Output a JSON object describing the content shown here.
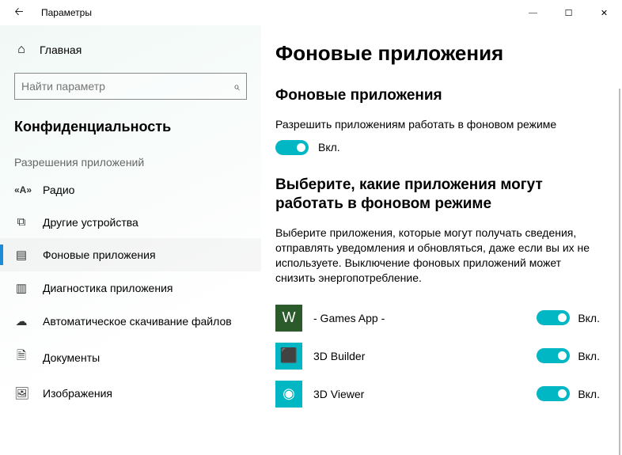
{
  "window": {
    "title": "Параметры"
  },
  "sidebar": {
    "home": "Главная",
    "search_placeholder": "Найти параметр",
    "section": "Конфиденциальность",
    "group": "Разрешения приложений",
    "items": [
      {
        "icon": "A",
        "label": "Радио"
      },
      {
        "icon": "devices",
        "label": "Другие устройства"
      },
      {
        "icon": "bgapps",
        "label": "Фоновые приложения"
      },
      {
        "icon": "diag",
        "label": "Диагностика приложения"
      },
      {
        "icon": "cloud",
        "label": "Автоматическое скачивание файлов"
      },
      {
        "icon": "doc",
        "label": "Документы"
      },
      {
        "icon": "img",
        "label": "Изображения"
      }
    ],
    "selected": 2
  },
  "main": {
    "heading": "Фоновые приложения",
    "sub1": "Фоновые приложения",
    "sub1_desc": "Разрешить приложениям работать в фоновом режиме",
    "master_state": "Вкл.",
    "sub2": "Выберите, какие приложения могут работать в фоновом режиме",
    "sub2_desc": "Выберите приложения, которые могут получать сведения, отправлять уведомления и обновляться, даже если вы их не используете. Выключение фоновых приложений может снизить энергопотребление.",
    "apps": [
      {
        "name": "- Games App -",
        "state": "Вкл.",
        "bg": "#2b5a2b",
        "letter": "W"
      },
      {
        "name": "3D Builder",
        "state": "Вкл.",
        "bg": "#00b7c3",
        "letter": "⬛"
      },
      {
        "name": "3D Viewer",
        "state": "Вкл.",
        "bg": "#00b7c3",
        "letter": "◉"
      }
    ]
  }
}
